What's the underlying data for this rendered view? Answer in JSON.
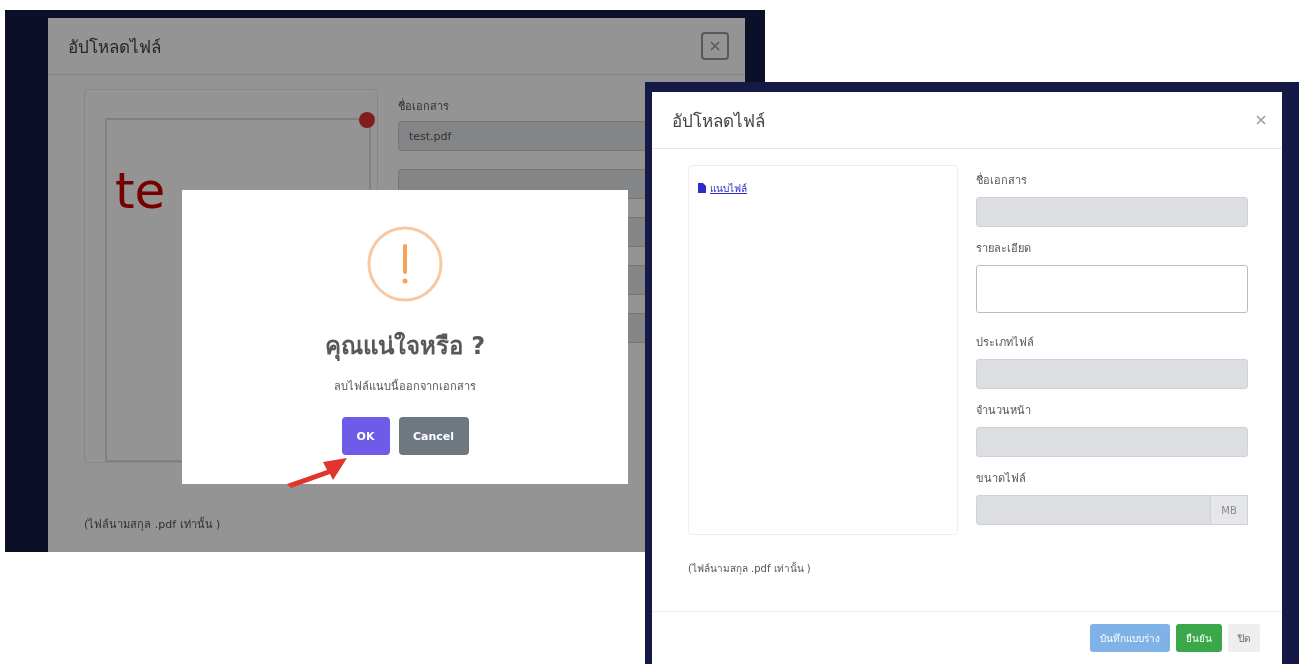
{
  "back_window": {
    "title": "อัปโหลดไฟล์",
    "preview_text": "te",
    "fields": [
      {
        "label": "ชื่อเอกสาร",
        "value": "test.pdf"
      }
    ],
    "note": "(ไฟล์นามสกุล .pdf เท่านั้น )"
  },
  "alert": {
    "title": "คุณแน่ใจหรือ ?",
    "message": "ลบไฟล์แนบนี้ออกจากเอกสาร",
    "buttons": [
      {
        "label": "OK",
        "kind": "confirm"
      },
      {
        "label": "Cancel",
        "kind": "cancel"
      }
    ]
  },
  "front_window": {
    "title": "อัปโหลดไฟล์",
    "attach_link": "แนบไฟล์",
    "fields": [
      {
        "label": "ชื่อเอกสาร",
        "kind": "input"
      },
      {
        "label": "รายละเอียด",
        "kind": "textarea"
      },
      {
        "label": "ประเภทไฟล์",
        "kind": "input"
      },
      {
        "label": "จำนวนหน้า",
        "kind": "input"
      },
      {
        "label": "ขนาดไฟล์",
        "kind": "unit",
        "unit": "MB"
      }
    ],
    "note": "(ไฟล์นามสกุล .pdf เท่านั้น )",
    "buttons": [
      {
        "label": "บันทึกแบบร่าง",
        "kind": "draft"
      },
      {
        "label": "ยืนยัน",
        "kind": "confirm"
      },
      {
        "label": "ปิด",
        "kind": "close"
      }
    ]
  }
}
